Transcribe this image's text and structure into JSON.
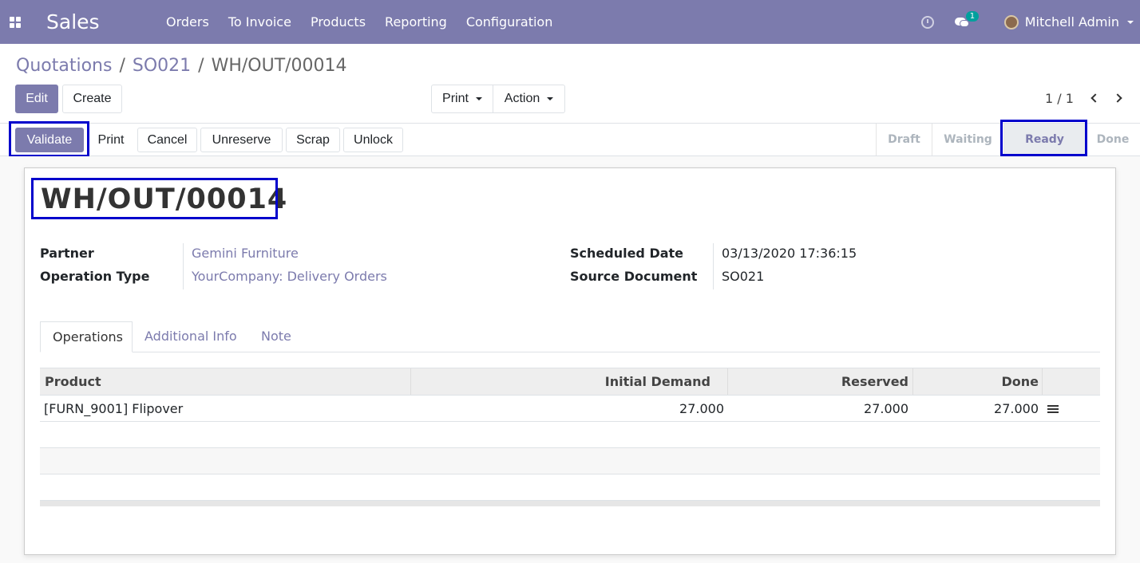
{
  "navbar": {
    "app_name": "Sales",
    "menu": [
      "Orders",
      "To Invoice",
      "Products",
      "Reporting",
      "Configuration"
    ],
    "chat_badge": "1",
    "user": "Mitchell Admin",
    "color": "#7c7bad"
  },
  "breadcrumb": {
    "items": [
      "Quotations",
      "SO021"
    ],
    "current": "WH/OUT/00014",
    "separator": "/"
  },
  "actions": {
    "edit": "Edit",
    "create": "Create",
    "print": "Print",
    "action": "Action"
  },
  "pager": {
    "text": "1 / 1"
  },
  "statusbar": {
    "buttons": [
      "Validate",
      "Print",
      "Cancel",
      "Unreserve",
      "Scrap",
      "Unlock"
    ],
    "stages": [
      "Draft",
      "Waiting",
      "Ready",
      "Done"
    ],
    "current_stage": "Ready"
  },
  "record": {
    "title": "WH/OUT/00014",
    "fields_left": [
      {
        "label": "Partner",
        "value": "Gemini Furniture"
      },
      {
        "label": "Operation Type",
        "value": "YourCompany: Delivery Orders"
      }
    ],
    "fields_right": [
      {
        "label": "Scheduled Date",
        "value": "03/13/2020 17:36:15"
      },
      {
        "label": "Source Document",
        "value": "SO021"
      }
    ]
  },
  "tabs": [
    "Operations",
    "Additional Info",
    "Note"
  ],
  "operations": {
    "columns": [
      "Product",
      "Initial Demand",
      "Reserved",
      "Done"
    ],
    "rows": [
      {
        "product": "[FURN_9001] Flipover",
        "initial_demand": "27.000",
        "reserved": "27.000",
        "done": "27.000"
      }
    ]
  }
}
